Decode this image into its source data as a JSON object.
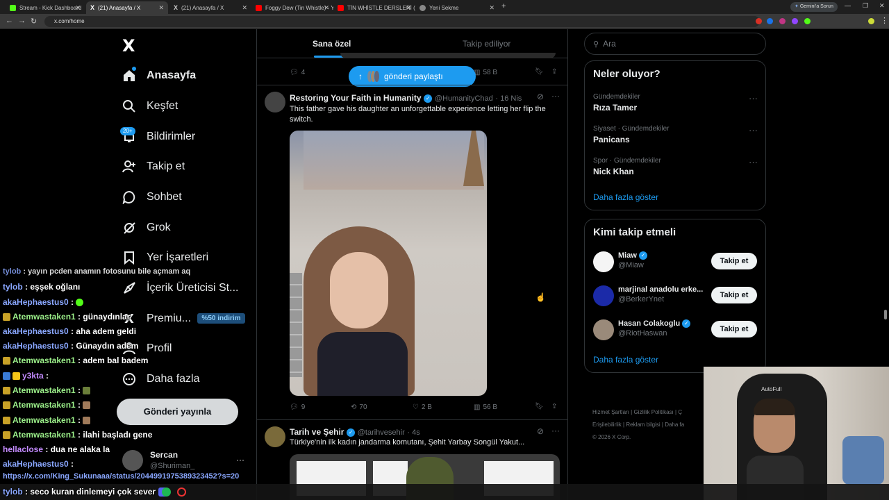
{
  "browser": {
    "tabs": [
      {
        "label": "Stream - Kick Dashboard",
        "color": "#53fc18"
      },
      {
        "label": "(21) Anasayfa / X",
        "color": "#ffffff"
      },
      {
        "label": "(21) Anasayfa / X",
        "color": "#ffffff"
      },
      {
        "label": "Foggy Dew (Tin Whistle) - YouT",
        "color": "#ff0000"
      },
      {
        "label": "TİN WHİSTLE DERSLERİ (B",
        "color": "#ff0000"
      },
      {
        "label": "Yeni Sekme",
        "color": "#888888"
      }
    ],
    "new_tab": "+",
    "gemini": "Gemini'a Sorun",
    "url": "x.com/home"
  },
  "nav": {
    "logo": "X",
    "items": [
      {
        "label": "Anasayfa",
        "icon": "home-icon"
      },
      {
        "label": "Keşfet",
        "icon": "search-icon"
      },
      {
        "label": "Bildirimler",
        "icon": "bell-icon"
      },
      {
        "label": "Takip et",
        "icon": "follow-icon"
      },
      {
        "label": "Sohbet",
        "icon": "chat-icon"
      },
      {
        "label": "Grok",
        "icon": "grok-icon"
      },
      {
        "label": "Yer İşaretleri",
        "icon": "bookmark-icon"
      },
      {
        "label": "İçerik Üreticisi St...",
        "icon": "rocket-icon"
      },
      {
        "label": "Premiu...",
        "icon": "x-icon"
      },
      {
        "label": "Profil",
        "icon": "profile-icon"
      },
      {
        "label": "Daha fazla",
        "icon": "more-icon"
      }
    ],
    "notif_badge": "20+",
    "premium_badge": "%50 indirim",
    "post_button": "Gönderi yayınla",
    "account_name": "Sercan",
    "account_handle": "@Shuriman_",
    "account_more": "···"
  },
  "feed": {
    "tabs": [
      "Sana özel",
      "Takip ediliyor"
    ],
    "new_posts": "gönderi paylaştı",
    "top_stats": {
      "replies": "4",
      "views": "58 B"
    },
    "tweet1": {
      "name": "Restoring Your Faith in Humanity",
      "handle": "@HumanityChad",
      "date": "· 16 Nis",
      "text": "This father gave his daughter an unforgettable experience letting her flip the switch.",
      "replies": "9",
      "retweets": "70",
      "likes": "2 B",
      "views": "56 B"
    },
    "tweet2": {
      "name": "Tarih ve Şehir",
      "handle": "@tarihvesehir",
      "date": "· 4s",
      "text": "Türkiye'nin ilk kadın jandarma komutanı, Şehit Yarbay Songül Yakut..."
    }
  },
  "search": {
    "placeholder": "Ara"
  },
  "trends": {
    "title": "Neler oluyor?",
    "items": [
      {
        "category": "Gündemdekiler",
        "name": "Rıza Tamer"
      },
      {
        "category": "Siyaset · Gündemdekiler",
        "name": "Panicans"
      },
      {
        "category": "Spor · Gündemdekiler",
        "name": "Nick Khan"
      }
    ],
    "more": "Daha fazla göster"
  },
  "who_to_follow": {
    "title": "Kimi takip etmeli",
    "items": [
      {
        "name": "Miaw",
        "handle": "@Miaw",
        "button": "Takip et"
      },
      {
        "name": "marjinal anadolu erke...",
        "handle": "@BerkerYnet",
        "button": "Takip et"
      },
      {
        "name": "Hasan Colakoglu",
        "handle": "@RiotHaswan",
        "button": "Takip et"
      }
    ],
    "more": "Daha fazla göster"
  },
  "footer": {
    "links": [
      "Hizmet Şartları",
      "Gizlilik Politikası",
      "Ç",
      "Erişilebilirlik",
      "Reklam bilgisi",
      "Daha fa"
    ],
    "copyright": "© 2026 X Corp."
  },
  "chat": [
    {
      "user": "tylob",
      "text": "yayın pcden anamın fotosunu bile açmam aq"
    },
    {
      "user": "tylob",
      "text": "eşşek oğlanı"
    },
    {
      "user": "akaHephaestus0",
      "text": ""
    },
    {
      "user": "Atemwastaken1",
      "text": "günaydınlar"
    },
    {
      "user": "akaHephaestus0",
      "text": "aha adem geldi"
    },
    {
      "user": "akaHephaestus0",
      "text": "Günaydın adem"
    },
    {
      "user": "Atemwastaken1",
      "text": "adem bal badem"
    },
    {
      "user": "y3kta",
      "text": ""
    },
    {
      "user": "Atemwastaken1",
      "text": ""
    },
    {
      "user": "Atemwastaken1",
      "text": ""
    },
    {
      "user": "Atemwastaken1",
      "text": ""
    },
    {
      "user": "Atemwastaken1",
      "text": "ilahi başladı gene"
    },
    {
      "user": "hellaclose",
      "text": "dua ne alaka la"
    },
    {
      "user": "akaHephaestus0",
      "text": ""
    },
    {
      "user": "",
      "text": "https://x.com/King_Sukunaaa/status/2044991975389323452?s=20"
    },
    {
      "user": "tylob",
      "text": "seco kuran dinlemeyi çok sever"
    }
  ],
  "webcam": {
    "chair_text": "AutoFull"
  }
}
